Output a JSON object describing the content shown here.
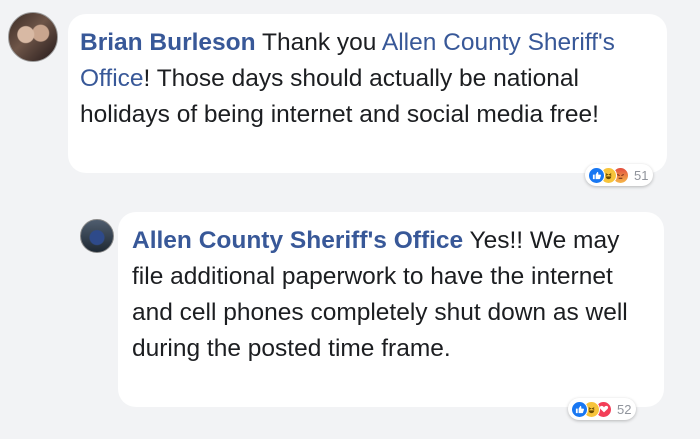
{
  "comments": [
    {
      "author": "Brian Burleson",
      "text_before": " Thank you ",
      "mention": "Allen County Sheriff's Office",
      "text_after": "! Those days should actually be national holidays of being internet and social media free!",
      "reaction_icons": [
        "like-icon",
        "haha-icon",
        "angry-icon"
      ],
      "reaction_count": "51"
    },
    {
      "author": "Allen County Sheriff's Office",
      "text": " Yes!! We may file additional paperwork to have the internet and cell phones completely shut down as well during the posted time frame.",
      "reaction_icons": [
        "like-icon",
        "haha-icon",
        "love-icon"
      ],
      "reaction_count": "52"
    }
  ],
  "colors": {
    "background": "#f2f3f5",
    "bubble": "#ffffff",
    "author_link": "#385898",
    "text": "#1c1e21",
    "count": "#90949c"
  }
}
